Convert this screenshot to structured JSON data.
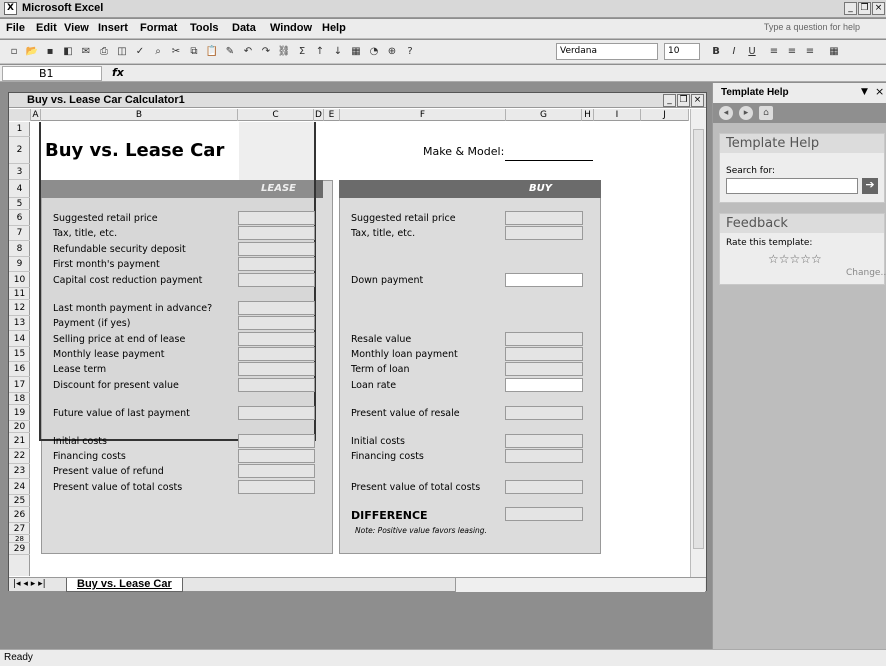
{
  "app": {
    "title": "Microsoft Excel",
    "help_prompt": "Type a question for help"
  },
  "menu": [
    "File",
    "Edit",
    "View",
    "Insert",
    "Format",
    "Tools",
    "Data",
    "Window",
    "Help"
  ],
  "toolbar": {
    "font": "Verdana",
    "size": "10",
    "bold": "B",
    "italic": "I",
    "underline": "U"
  },
  "formula": {
    "cell_ref": "B1",
    "fx": "fx"
  },
  "workbook": {
    "title": "Buy vs. Lease Car Calculator1",
    "sheet_tab": "Buy vs. Lease Car"
  },
  "columns": [
    "A",
    "B",
    "C",
    "D",
    "E",
    "F",
    "G",
    "H",
    "I",
    "J"
  ],
  "rows": [
    "1",
    "2",
    "3",
    "4",
    "5",
    "6",
    "7",
    "8",
    "9",
    "10",
    "11",
    "12",
    "13",
    "14",
    "15",
    "16",
    "17",
    "18",
    "19",
    "20",
    "21",
    "22",
    "23",
    "24",
    "25",
    "26",
    "27",
    "28",
    "29"
  ],
  "sheet": {
    "heading": "Buy vs. Lease Car",
    "make_model_label": "Make & Model:",
    "lease_header": "LEASE",
    "buy_header": "BUY",
    "lease_labels": {
      "r6": "Suggested retail price",
      "r7": "Tax, title, etc.",
      "r8": "Refundable security deposit",
      "r9": "First month's payment",
      "r10": "Capital cost reduction payment",
      "r12": "Last month payment in advance?",
      "r13": "Payment (if yes)",
      "r14": "Selling price at end of lease",
      "r15": "Monthly lease payment",
      "r16": "Lease term",
      "r17": "Discount for present value",
      "r19": "Future value of last payment",
      "r21": "Initial costs",
      "r22": "Financing costs",
      "r23": "Present value of refund",
      "r24": "Present value of total costs"
    },
    "buy_labels": {
      "r6": "Suggested retail price",
      "r7": "Tax, title, etc.",
      "r10": "Down payment",
      "r14": "Resale value",
      "r15": "Monthly loan payment",
      "r16": "Term of loan",
      "r17": "Loan rate",
      "r19": "Present value of resale",
      "r21": "Initial costs",
      "r22": "Financing costs",
      "r24": "Present value of total costs",
      "r26": "DIFFERENCE"
    },
    "note": "Note: Positive value favors leasing."
  },
  "taskpane": {
    "title": "Template Help",
    "section1": "Template Help",
    "search_label": "Search for:",
    "section2": "Feedback",
    "rate_label": "Rate this template:",
    "stars": "☆☆☆☆☆",
    "change": "Change..."
  },
  "status": {
    "text": "Ready"
  }
}
